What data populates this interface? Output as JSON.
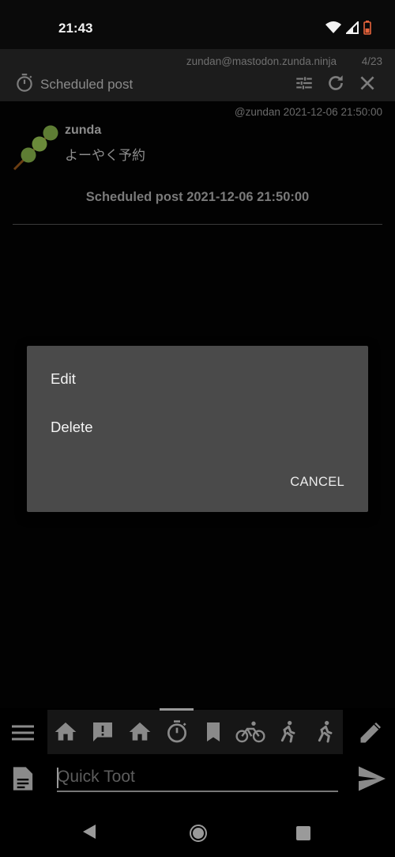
{
  "status": {
    "time": "21:43"
  },
  "column": {
    "account": "zundan@mastodon.zunda.ninja",
    "count": "4/23",
    "title": "Scheduled post"
  },
  "post": {
    "meta": "@zundan  2021-12-06 21:50:00",
    "name": "zunda",
    "text": "よーやく予約",
    "schedule": "Scheduled post 2021-12-06 21:50:00"
  },
  "dialog": {
    "edit": "Edit",
    "delete": "Delete",
    "cancel": "CANCEL"
  },
  "tabs": [
    {
      "icon": "home-icon"
    },
    {
      "icon": "notification-icon"
    },
    {
      "icon": "home-icon"
    },
    {
      "icon": "timer-icon",
      "selected": true
    },
    {
      "icon": "bookmark-icon"
    },
    {
      "icon": "bike-icon"
    },
    {
      "icon": "run-icon"
    },
    {
      "icon": "run-icon"
    }
  ],
  "toot": {
    "placeholder": "Quick Toot"
  },
  "colors": {
    "background": "#000000",
    "header": "#1c1c1c",
    "dialog": "#4a4a4a"
  }
}
